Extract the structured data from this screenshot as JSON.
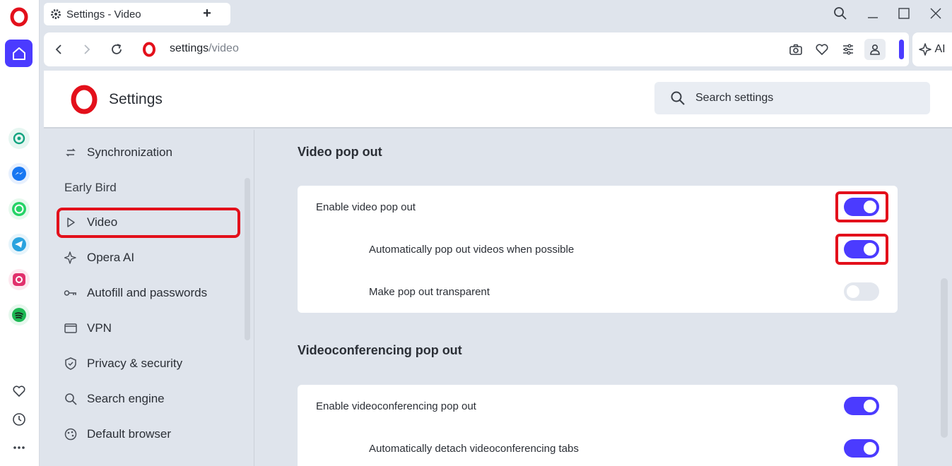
{
  "browser": {
    "tab_title": "Settings - Video",
    "new_tab_symbol": "+",
    "url_host": "settings",
    "url_path": "/video",
    "ai_label": "AI",
    "accent_color": "#4b3bff",
    "highlight_color": "#e3101b"
  },
  "sidebar_apps": [
    {
      "name": "chatgpt-icon",
      "color": "#10a37f"
    },
    {
      "name": "messenger-icon",
      "color": "#1877f2"
    },
    {
      "name": "whatsapp-icon",
      "color": "#25d366"
    },
    {
      "name": "telegram-icon",
      "color": "#2aa3df"
    },
    {
      "name": "instagram-icon",
      "color": "#e1306c"
    },
    {
      "name": "spotify-icon",
      "color": "#1db954"
    }
  ],
  "settings": {
    "title": "Settings",
    "search_placeholder": "Search settings"
  },
  "nav": {
    "synchronization": "Synchronization",
    "early_bird": "Early Bird",
    "video": "Video",
    "opera_ai": "Opera AI",
    "autofill": "Autofill and passwords",
    "vpn": "VPN",
    "privacy": "Privacy & security",
    "search_engine": "Search engine",
    "default_browser": "Default browser"
  },
  "main": {
    "video_popout": {
      "title": "Video pop out",
      "rows": [
        {
          "label": "Enable video pop out",
          "enabled": true
        },
        {
          "label": "Automatically pop out videos when possible",
          "enabled": true
        },
        {
          "label": "Make pop out transparent",
          "enabled": false
        }
      ]
    },
    "videoconf_popout": {
      "title": "Videoconferencing pop out",
      "rows": [
        {
          "label": "Enable videoconferencing pop out",
          "enabled": true
        },
        {
          "label": "Automatically detach videoconferencing tabs",
          "enabled": true
        }
      ]
    }
  }
}
